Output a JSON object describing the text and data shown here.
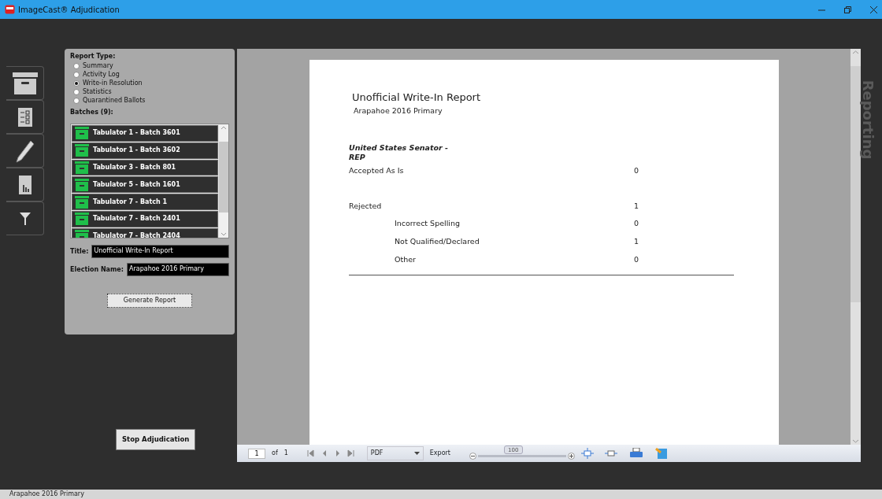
{
  "window": {
    "title": "ImageCast® Adjudication"
  },
  "side_tabs": [
    {
      "kind": "archive"
    },
    {
      "kind": "checklist"
    },
    {
      "kind": "pencil"
    },
    {
      "kind": "chart"
    },
    {
      "kind": "filter"
    }
  ],
  "report_panel": {
    "report_type_label": "Report Type:",
    "report_types": [
      {
        "label": "Summary",
        "selected": false
      },
      {
        "label": "Activity Log",
        "selected": false
      },
      {
        "label": "Write-in Resolution",
        "selected": true
      },
      {
        "label": "Statistics",
        "selected": false
      },
      {
        "label": "Quarantined Ballots",
        "selected": false
      }
    ],
    "batches_label": "Batches (9):",
    "batches": [
      "Tabulator 1 - Batch 3601",
      "Tabulator 1 - Batch 3602",
      "Tabulator 3 - Batch 801",
      "Tabulator 5 - Batch 1601",
      "Tabulator 7 - Batch 1",
      "Tabulator 7 - Batch 2401",
      "Tabulator 7 - Batch 2404"
    ],
    "title_label": "Title:",
    "title_value": "Unofficial Write-In Report",
    "election_label": "Election Name:",
    "election_value": "Arapahoe 2016 Primary",
    "generate_button": "Generate Report"
  },
  "stop_button": "Stop Adjudication",
  "report": {
    "title": "Unofficial Write-In Report",
    "subtitle": "Arapahoe 2016 Primary",
    "contest": "United States Senator - REP",
    "rows": [
      {
        "label": "Accepted As Is",
        "value": "0"
      },
      {
        "label": "Rejected",
        "value": "1",
        "children": [
          {
            "label": "Incorrect Spelling",
            "value": "0"
          },
          {
            "label": "Not Qualified/Declared",
            "value": "1"
          },
          {
            "label": "Other",
            "value": "0"
          }
        ]
      }
    ]
  },
  "toolbar": {
    "page": "1",
    "of_label": "of",
    "page_count": "1",
    "format": "PDF",
    "export": "Export",
    "zoom": {
      "reading": "100",
      "level": 0.4
    }
  },
  "side_label": "Reporting",
  "status_bar": "Arapahoe 2016 Primary"
}
